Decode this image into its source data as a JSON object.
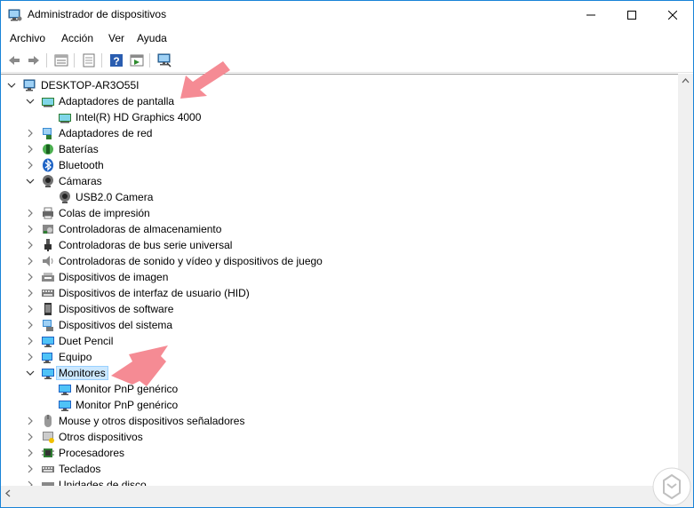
{
  "window": {
    "title": "Administrador de dispositivos"
  },
  "menu": {
    "items": [
      "Archivo",
      "Acción",
      "Ver",
      "Ayuda"
    ]
  },
  "toolbar": {
    "buttons": [
      "back-icon",
      "forward-icon",
      "properties-view-icon",
      "list-view-icon",
      "help-icon",
      "run-icon",
      "scan-hardware-icon"
    ]
  },
  "tree": {
    "root": "DESKTOP-AR3O55I",
    "items": [
      {
        "label": "Adaptadores de pantalla",
        "expanded": true,
        "icon": "display-adapter-icon"
      },
      {
        "label": "Intel(R) HD Graphics 4000",
        "icon": "display-adapter-icon",
        "child": true
      },
      {
        "label": "Adaptadores de red",
        "icon": "network-adapter-icon"
      },
      {
        "label": "Baterías",
        "icon": "battery-icon"
      },
      {
        "label": "Bluetooth",
        "icon": "bluetooth-icon"
      },
      {
        "label": "Cámaras",
        "expanded": true,
        "icon": "camera-icon"
      },
      {
        "label": "USB2.0 Camera",
        "icon": "camera-icon",
        "child": true
      },
      {
        "label": "Colas de impresión",
        "icon": "printer-icon"
      },
      {
        "label": "Controladoras de almacenamiento",
        "icon": "storage-icon"
      },
      {
        "label": "Controladoras de bus serie universal",
        "icon": "usb-icon"
      },
      {
        "label": "Controladoras de sonido y vídeo y dispositivos de juego",
        "icon": "speaker-icon"
      },
      {
        "label": "Dispositivos de imagen",
        "icon": "imaging-icon"
      },
      {
        "label": "Dispositivos de interfaz de usuario (HID)",
        "icon": "hid-icon"
      },
      {
        "label": "Dispositivos de software",
        "icon": "software-device-icon"
      },
      {
        "label": "Dispositivos del sistema",
        "icon": "system-device-icon"
      },
      {
        "label": "Duet Pencil",
        "icon": "monitor-icon"
      },
      {
        "label": "Equipo",
        "icon": "computer-icon"
      },
      {
        "label": "Monitores",
        "expanded": true,
        "selected": true,
        "icon": "monitor-icon"
      },
      {
        "label": "Monitor PnP genérico",
        "icon": "monitor-icon",
        "child": true
      },
      {
        "label": "Monitor PnP genérico",
        "icon": "monitor-icon",
        "child": true
      },
      {
        "label": "Mouse y otros dispositivos señaladores",
        "icon": "mouse-icon"
      },
      {
        "label": "Otros dispositivos",
        "icon": "other-device-icon"
      },
      {
        "label": "Procesadores",
        "icon": "processor-icon"
      },
      {
        "label": "Teclados",
        "icon": "keyboard-icon"
      },
      {
        "label": "Unidades de disco",
        "icon": "disk-drive-icon"
      }
    ]
  },
  "colors": {
    "accent": "#1883d7",
    "selection": "#cce8ff",
    "arrow": "#f58b94"
  }
}
